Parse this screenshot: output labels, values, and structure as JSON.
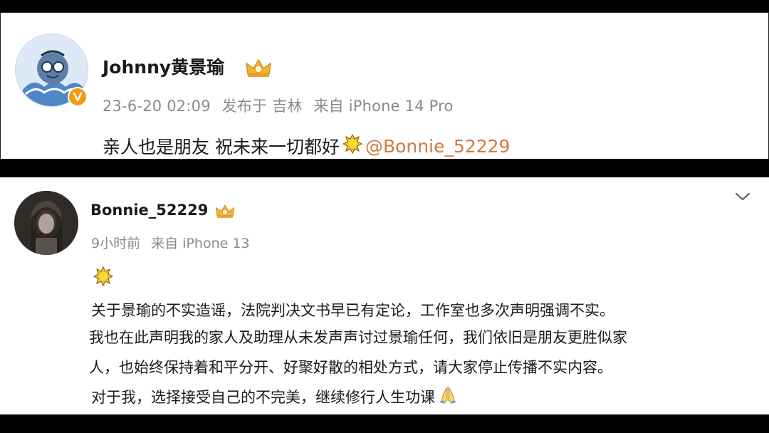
{
  "post1": {
    "username": "Johnny黄景瑜",
    "meta": [
      "23-6-20 02:09",
      "发布于 吉林",
      "来自 iPhone 14 Pro"
    ],
    "text": "亲人也是朋友 祝未来一切都好",
    "mention": "@Bonnie_52229",
    "icons": [
      "avatar",
      "verified-v-badge",
      "vip-crown-icon",
      "sun-emoji"
    ]
  },
  "post2": {
    "username": "Bonnie_52229",
    "meta": [
      "9小时前",
      "来自 iPhone 13"
    ],
    "lines": [
      " 关于景瑜的不实造谣，法院判决文书早已有定论，工作室也多次声明强调不实。",
      "我也在此声明我的家人及助理从未发声声讨过景瑜任何，我们依旧是朋友更胜似家",
      "人，也始终保持着和平分开、好聚好散的相处方式，请大家停止传播不实内容。",
      " 对于我，选择接受自己的不完美，继续修行人生功课"
    ],
    "icons": [
      "avatar",
      "vip-crown-icon",
      "sun-emoji",
      "pray-emoji",
      "chevron-down-icon"
    ]
  },
  "colors": {
    "mention": "#d07a42",
    "meta": "#8a8a8a",
    "text": "#1a1a1a",
    "badge": "#f59b0f"
  }
}
